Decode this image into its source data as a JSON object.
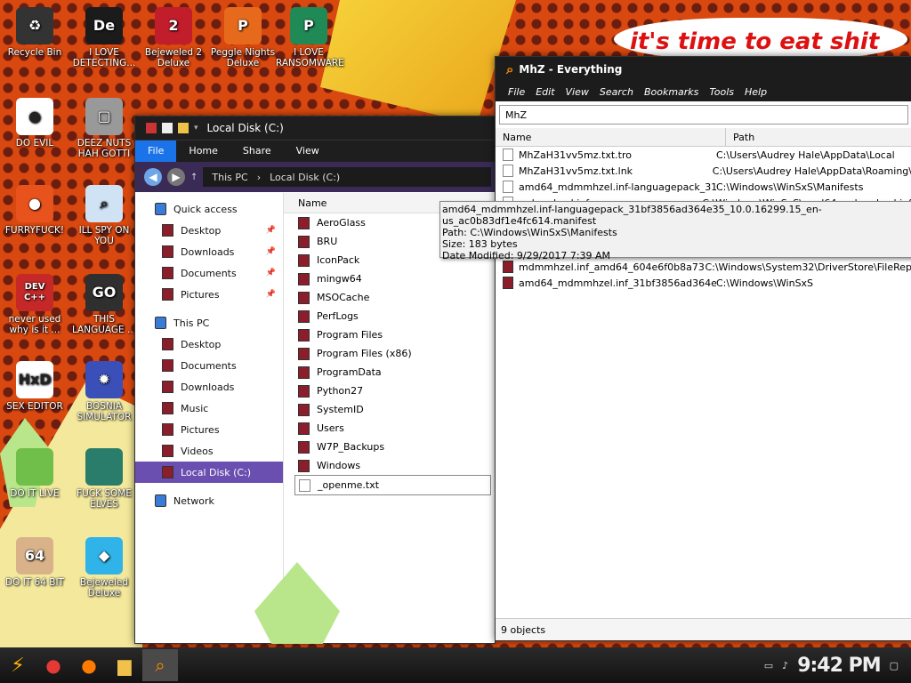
{
  "wallpaper": {
    "speech_text": "it's time to eat shit"
  },
  "desktop_icons": [
    {
      "label": "Recycle Bin",
      "color": "#333333",
      "glyph": "♻"
    },
    {
      "label": "I LOVE DETECTING...",
      "color": "#1b1b1b",
      "glyph": "De"
    },
    {
      "label": "Bejeweled 2 Deluxe",
      "color": "#c21d2b",
      "glyph": "2"
    },
    {
      "label": "Peggle Nights Deluxe",
      "color": "#e76a1c",
      "glyph": "P"
    },
    {
      "label": "I LOVE RANSOMWARE",
      "color": "#1f8a55",
      "glyph": "P"
    },
    {
      "label": "DO EVIL",
      "color": "#ffffff",
      "glyph": "●"
    },
    {
      "label": "DEEZ NUTS HAH GOTTI",
      "color": "#999999",
      "glyph": "▢"
    },
    {
      "label": "FURRYFUCK!",
      "color": "#e8521c",
      "glyph": "●"
    },
    {
      "label": "ILL SPY ON YOU",
      "color": "#cfe3f5",
      "glyph": "⌕"
    },
    {
      "label": "never used why is it ...",
      "color": "#c62828",
      "glyph": "DEV C++"
    },
    {
      "label": "THIS LANGUAGE ...",
      "color": "#2f2f2f",
      "glyph": "GO"
    },
    {
      "label": "SEX EDITOR",
      "color": "#ffffff",
      "glyph": "HxD"
    },
    {
      "label": "BOSNIA SIMULATOR",
      "color": "#3b4fb8",
      "glyph": "✹"
    },
    {
      "label": "DO IT LIVE",
      "color": "#6fbf4a",
      "glyph": ""
    },
    {
      "label": "FUCK SOME ELVES",
      "color": "#2a7d6b",
      "glyph": ""
    },
    {
      "label": "DO IT 64 BIT",
      "color": "#d9b28a",
      "glyph": "64"
    },
    {
      "label": "Bejeweled Deluxe",
      "color": "#2fb3e8",
      "glyph": "◆"
    }
  ],
  "explorer": {
    "title": "Local Disk (C:)",
    "tabs": [
      "File",
      "Home",
      "Share",
      "View"
    ],
    "breadcrumb": [
      "This PC",
      "Local Disk (C:)"
    ],
    "column_name": "Name",
    "nav": [
      {
        "label": "Quick access",
        "type": "header"
      },
      {
        "label": "Desktop",
        "pin": true
      },
      {
        "label": "Downloads",
        "pin": true
      },
      {
        "label": "Documents",
        "pin": true
      },
      {
        "label": "Pictures",
        "pin": true
      },
      {
        "label": "This PC",
        "type": "header"
      },
      {
        "label": "Desktop"
      },
      {
        "label": "Documents"
      },
      {
        "label": "Downloads"
      },
      {
        "label": "Music"
      },
      {
        "label": "Pictures"
      },
      {
        "label": "Videos"
      },
      {
        "label": "Local Disk (C:)",
        "selected": true
      },
      {
        "label": "Network",
        "type": "header"
      }
    ],
    "files": [
      "AeroGlass",
      "BRU",
      "IconPack",
      "mingw64",
      "MSOCache",
      "PerfLogs",
      "Program Files",
      "Program Files (x86)",
      "ProgramData",
      "Python27",
      "SystemID",
      "Users",
      "W7P_Backups",
      "Windows",
      "_openme.txt"
    ]
  },
  "everything": {
    "title": "MhZ - Everything",
    "menu": [
      "File",
      "Edit",
      "View",
      "Search",
      "Bookmarks",
      "Tools",
      "Help"
    ],
    "search_value": "MhZ",
    "columns": {
      "name": "Name",
      "path": "Path"
    },
    "rows": [
      {
        "name": "MhZaH31vv5mz.txt.tro",
        "path": "C:\\Users\\Audrey Hale\\AppData\\Local",
        "dark": false
      },
      {
        "name": "MhZaH31vv5mz.txt.lnk",
        "path": "C:\\Users\\Audrey Hale\\AppData\\Roaming\\",
        "dark": false
      },
      {
        "name": "amd64_mdmmhzel.inf-languagepack_31bf38...",
        "path": "C:\\Windows\\WinSxS\\Manifests",
        "dark": false
      },
      {
        "name": "mdmmhzel.inf",
        "path": "C:\\Windows\\WinSxS\\amd64_mdmmhzel.inf",
        "dark": false
      },
      {
        "name": "",
        "path": "",
        "dark": false
      },
      {
        "name": "",
        "path": "",
        "dark": false
      },
      {
        "name": "",
        "path": "",
        "dark": true
      },
      {
        "name": "mdmmhzel.inf_amd64_604e6f0b8a737ef3",
        "path": "C:\\Windows\\System32\\DriverStore\\FileRep",
        "dark": true
      },
      {
        "name": "amd64_mdmmhzel.inf_31bf3856ad364e35_1...",
        "path": "C:\\Windows\\WinSxS",
        "dark": true
      }
    ],
    "tooltip": [
      "amd64_mdmmhzel.inf-languagepack_31bf3856ad364e35_10.0.16299.15_en-us_ac0b83df1e4fc614.manifest",
      "Path: C:\\Windows\\WinSxS\\Manifests",
      "Size: 183 bytes",
      "Date Modified: 9/29/2017 7:39 AM"
    ],
    "status": "9 objects"
  },
  "taskbar": {
    "clock": "9:42 PM"
  }
}
